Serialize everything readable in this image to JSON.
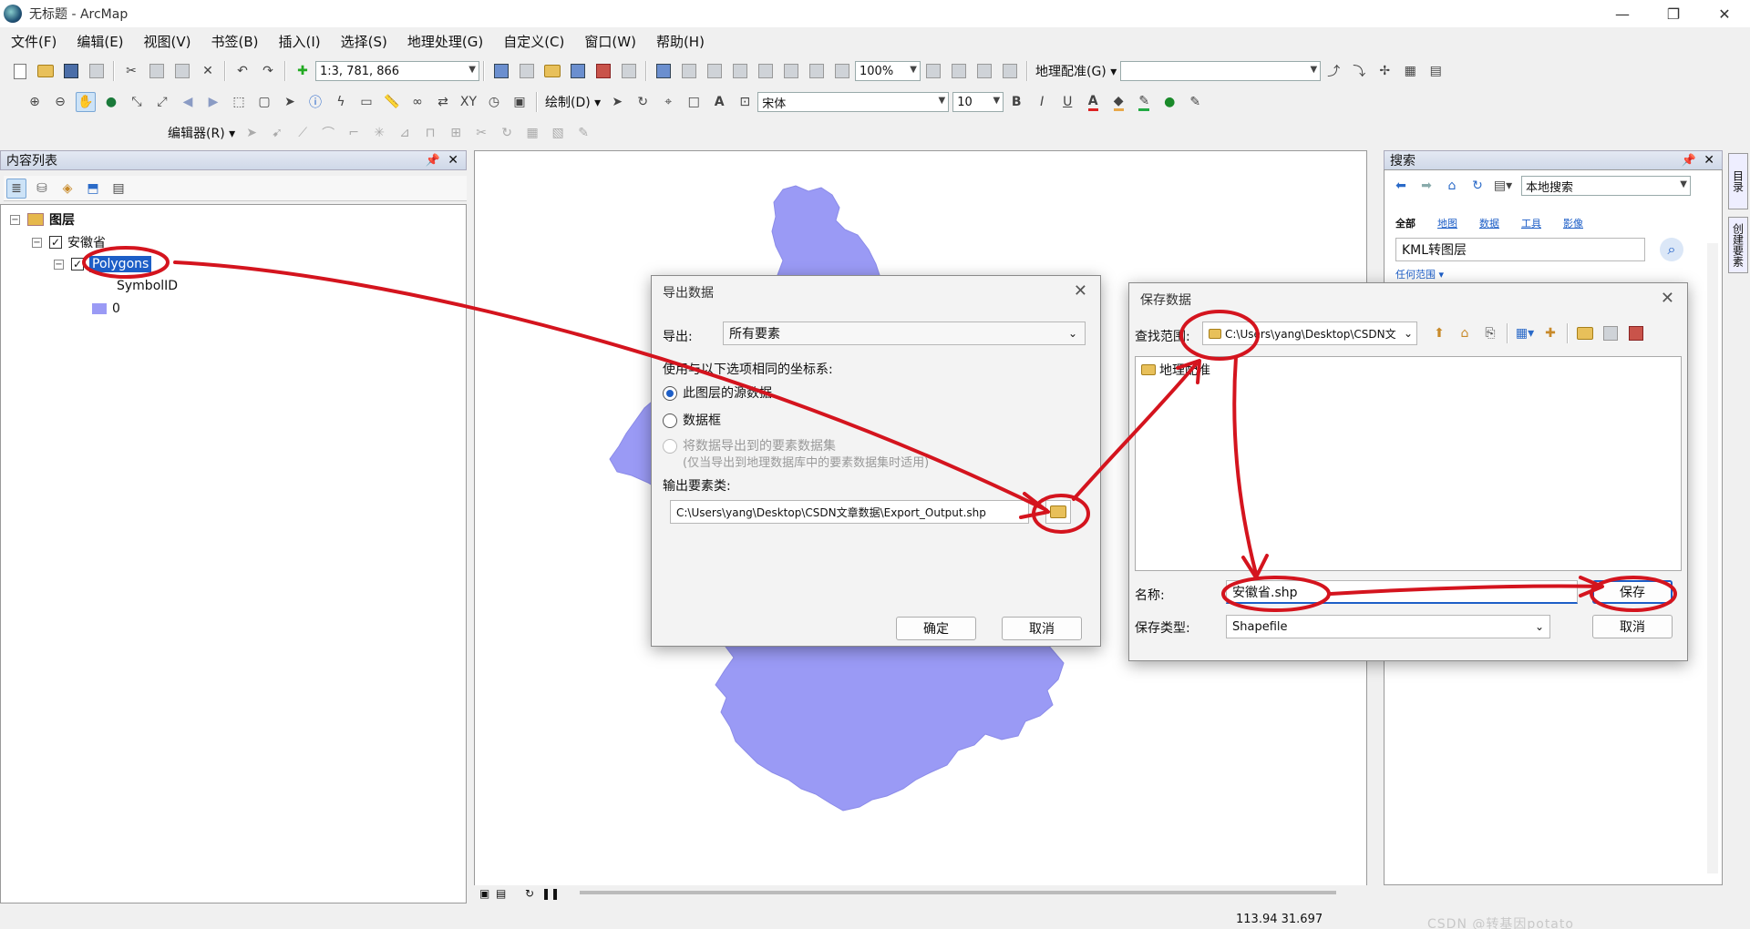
{
  "window": {
    "title": "无标题 - ArcMap",
    "controls": [
      "—",
      "❐",
      "✕"
    ]
  },
  "menu": [
    "文件(F)",
    "编辑(E)",
    "视图(V)",
    "书签(B)",
    "插入(I)",
    "选择(S)",
    "地理处理(G)",
    "自定义(C)",
    "窗口(W)",
    "帮助(H)"
  ],
  "toolbar": {
    "scale": "1:3, 781, 866",
    "zoom": "100%",
    "georef_label": "地理配准(G) ▾",
    "draw_label": "绘制(D) ▾",
    "font_name": "宋体",
    "font_size": "10",
    "bold": "B",
    "italic": "I",
    "underline": "U",
    "editor_label": "编辑器(R) ▾"
  },
  "toc": {
    "title": "内容列表",
    "layers_root": "图层",
    "group": "安徽省",
    "layer": "Polygons",
    "field": "SymbolID",
    "value": "0"
  },
  "search_panel": {
    "title": "搜索",
    "scope": "本地搜索",
    "tabs": [
      "全部",
      "地图",
      "数据",
      "工具",
      "影像"
    ],
    "query": "KML转图层",
    "range": "任何范围 ▾"
  },
  "vertical_tabs": [
    "目录",
    "创建要素"
  ],
  "export_dialog": {
    "title": "导出数据",
    "export_label": "导出:",
    "export_value": "所有要素",
    "coord_label": "使用与以下选项相同的坐标系:",
    "opt1": "此图层的源数据",
    "opt2": "数据框",
    "opt3": "将数据导出到的要素数据集",
    "opt3_note": "(仅当导出到地理数据库中的要素数据集时适用)",
    "output_label": "输出要素类:",
    "output_path": "C:\\Users\\yang\\Desktop\\CSDN文章数据\\Export_Output.shp",
    "ok": "确定",
    "cancel": "取消"
  },
  "save_dialog": {
    "title": "保存数据",
    "lookin_label": "查找范围:",
    "lookin_value": "C:\\Users\\yang\\Desktop\\CSDN文",
    "folder_item": "地理配准",
    "name_label": "名称:",
    "name_value": "安徽省.shp",
    "type_label": "保存类型:",
    "type_value": "Shapefile",
    "save": "保存",
    "cancel": "取消"
  },
  "status": {
    "coords": "113.94  31.697",
    "watermark": "CSDN @转基因potato"
  },
  "colors": {
    "polygon_fill": "#9a9af5",
    "annotation_red": "#d4141e",
    "selection_blue": "#1d5ec7"
  }
}
